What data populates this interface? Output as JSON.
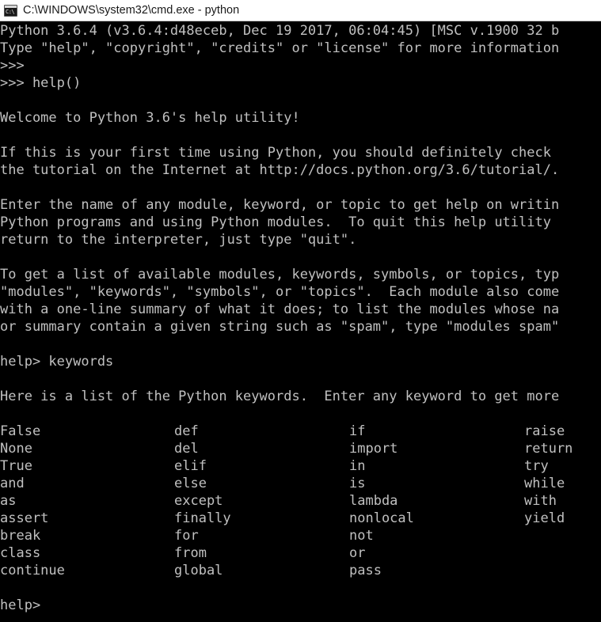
{
  "window": {
    "title": "C:\\WINDOWS\\system32\\cmd.exe - python",
    "icon": "cmd-console-icon",
    "icon_glyph": "C:\\",
    "titlebar_bg": "#ffffff",
    "titlebar_fg": "#1a1a1a",
    "terminal_bg": "#000000",
    "terminal_fg": "#c0c0c0"
  },
  "terminal": {
    "lines": [
      "Python 3.6.4 (v3.6.4:d48eceb, Dec 19 2017, 06:04:45) [MSC v.1900 32 b",
      "Type \"help\", \"copyright\", \"credits\" or \"license\" for more information",
      ">>>",
      ">>> help()",
      "",
      "Welcome to Python 3.6's help utility!",
      "",
      "If this is your first time using Python, you should definitely check",
      "the tutorial on the Internet at http://docs.python.org/3.6/tutorial/.",
      "",
      "Enter the name of any module, keyword, or topic to get help on writin",
      "Python programs and using Python modules.  To quit this help utility",
      "return to the interpreter, just type \"quit\".",
      "",
      "To get a list of available modules, keywords, symbols, or topics, typ",
      "\"modules\", \"keywords\", \"symbols\", or \"topics\".  Each module also come",
      "with a one-line summary of what it does; to list the modules whose na",
      "or summary contain a given string such as \"spam\", type \"modules spam\"",
      "",
      "help> keywords",
      "",
      "Here is a list of the Python keywords.  Enter any keyword to get more",
      ""
    ],
    "keyword_rows": [
      [
        "False",
        "def",
        "if",
        "raise"
      ],
      [
        "None",
        "del",
        "import",
        "return"
      ],
      [
        "True",
        "elif",
        "in",
        "try"
      ],
      [
        "and",
        "else",
        "is",
        "while"
      ],
      [
        "as",
        "except",
        "lambda",
        "with"
      ],
      [
        "assert",
        "finally",
        "nonlocal",
        "yield"
      ],
      [
        "break",
        "for",
        "not",
        ""
      ],
      [
        "class",
        "from",
        "or",
        ""
      ],
      [
        "continue",
        "global",
        "pass",
        ""
      ]
    ],
    "trailing_lines": [
      "",
      "help>"
    ]
  }
}
